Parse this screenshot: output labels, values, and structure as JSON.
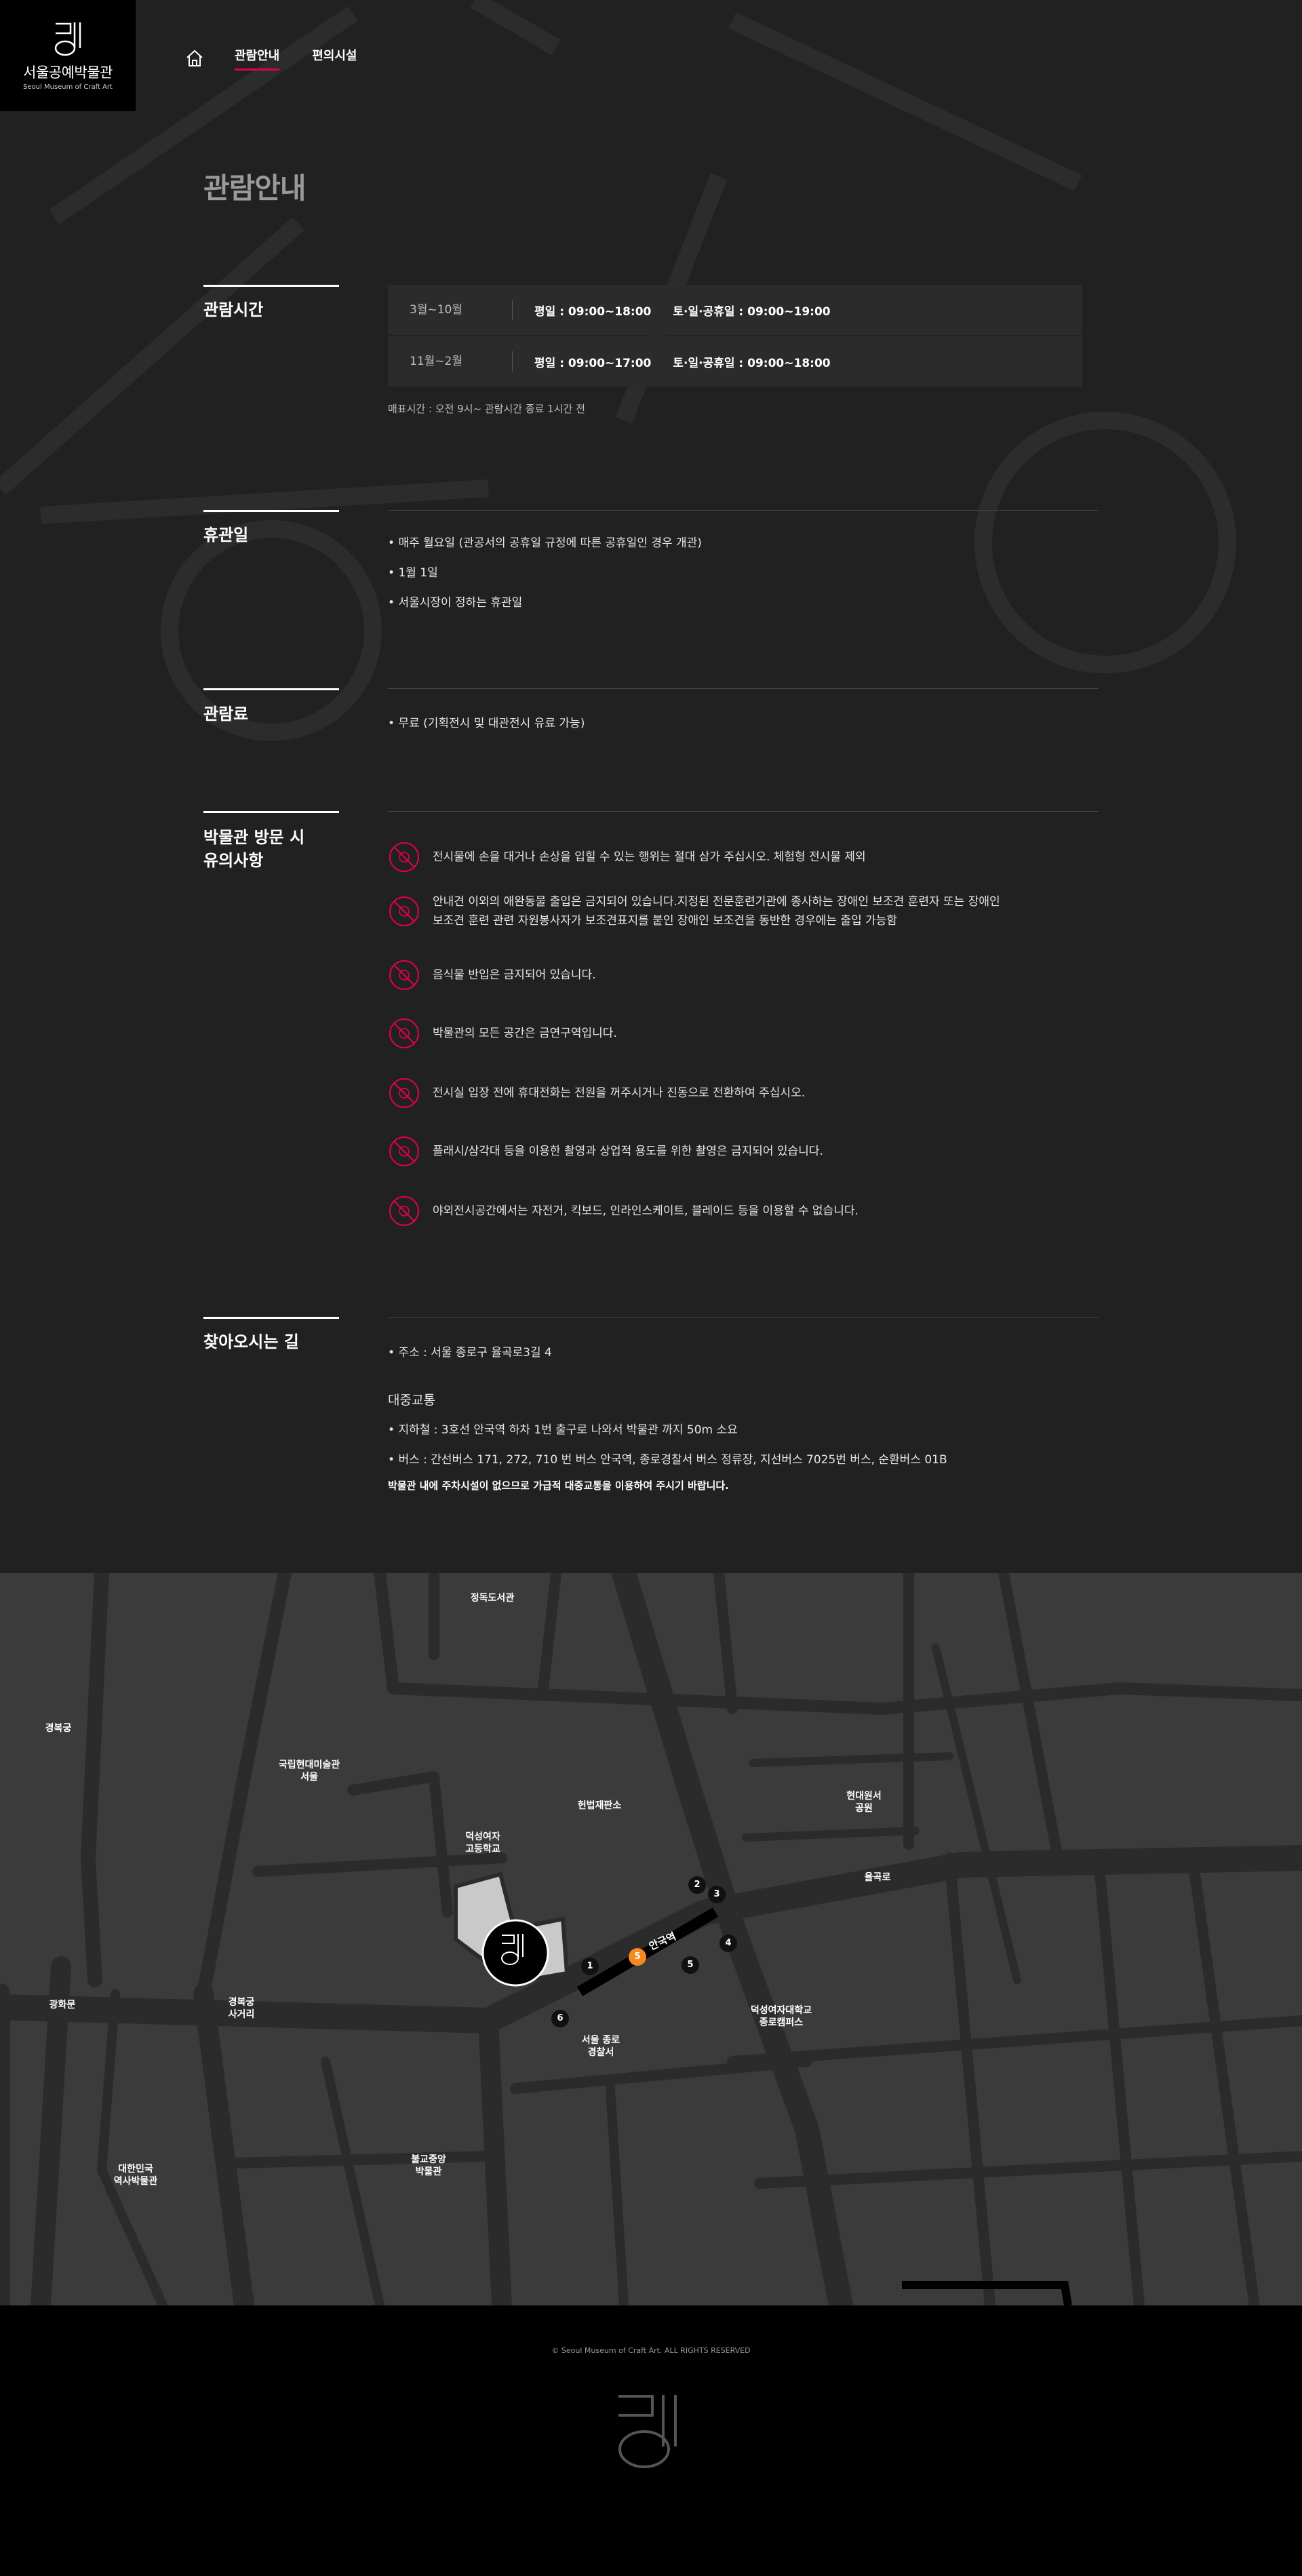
{
  "header": {
    "logo_ko": "서울공예박물관",
    "logo_en": "Seoul Museum of Craft Art",
    "nav": [
      {
        "label": "관람안내",
        "active": true
      },
      {
        "label": "편의시설",
        "active": false
      }
    ],
    "home_icon": "home-icon"
  },
  "page": {
    "title": "관람안내"
  },
  "hours": {
    "title": "관람시간",
    "rows": [
      {
        "season": "3월~10월",
        "weekday": "평일 : 09:00~18:00",
        "weekend": "토·일·공휴일 : 09:00~19:00"
      },
      {
        "season": "11월~2월",
        "weekday": "평일 : 09:00~17:00",
        "weekend": "토·일·공휴일 : 09:00~18:00"
      }
    ],
    "note": "매표시간 : 오전 9시~ 관람시간 종료 1시간 전"
  },
  "closed": {
    "title": "휴관일",
    "items": [
      "매주 월요일 (관공서의 공휴일 규정에 따른 공휴일인 경우 개관)",
      "1월 1일",
      "서울시장이 정하는 휴관일"
    ]
  },
  "fee": {
    "title": "관람료",
    "items": [
      "무료 (기획전시 및 대관전시 유료 가능)"
    ]
  },
  "notices": {
    "title_line1": "박물관 방문 시",
    "title_line2": "유의사항",
    "icon": "prohibited-icon",
    "accent": "#e6004c",
    "items": [
      {
        "line1": "전시물에 손을 대거나 손상을 입힐 수 있는 행위는 절대 삼가 주십시오. 체험형 전시물 제외",
        "line2": ""
      },
      {
        "line1": "안내견 이외의 애완동물 출입은 금지되어 있습니다.지정된 전문훈련기관에 종사하는 장애인 보조견 훈련자 또는 장애인",
        "line2": "보조견 훈련 관련 자원봉사자가 보조견표지를 붙인 장애인 보조견을 동반한 경우에는 출입 가능함"
      },
      {
        "line1": "음식물 반입은 금지되어 있습니다.",
        "line2": ""
      },
      {
        "line1": "박물관의 모든 공간은 금연구역입니다.",
        "line2": ""
      },
      {
        "line1": "전시실 입장 전에 휴대전화는 전원을 꺼주시거나 진동으로 전환하여 주십시오.",
        "line2": ""
      },
      {
        "line1": "플래시/삼각대 등을 이용한 촬영과 상업적 용도를 위한 촬영은 금지되어 있습니다.",
        "line2": ""
      },
      {
        "line1": "야외전시공간에서는 자전거, 킥보드, 인라인스케이트, 블레이드 등을 이용할 수 없습니다.",
        "line2": ""
      }
    ]
  },
  "directions": {
    "title": "찾아오시는 길",
    "address": "주소 : 서울 종로구 율곡로3길 4",
    "transit_heading": "대중교통",
    "subway": "지하철 : 3호선 안국역 하차 1번 출구로 나와서 박물관 까지 50m 소요",
    "bus": "버스 : 간선버스 171, 272, 710 번 버스 안국역, 종로경찰서 버스 정류장, 지선버스 7025번 버스, 순환버스 01B",
    "parking_note": "박물관 내에 주차시설이 없으므로 가급적 대중교통을 이용하여 주시기 바랍니다."
  },
  "map": {
    "labels": {
      "jeongdok": "정독도서관",
      "gyeongbokgung": "경복궁",
      "mmca": "국립현대미술관\n서울",
      "hyundai": "현대원서\n공원",
      "heonbeop": "헌법재판소",
      "duksung_hs": "덕성여자\n고등학교",
      "yulgokro": "율곡로",
      "gwanghwamun": "광화문",
      "gyeongbok_sageori": "경복궁\n사거리",
      "police": "서울 종로\n경찰서",
      "duksung_univ": "덕성여자대학교\n종로캠퍼스",
      "history_museum": "대한민국\n역사박물관",
      "buddhist_museum": "불교중앙\n박물관"
    },
    "station": "안국역",
    "exits": [
      "1",
      "2",
      "3",
      "4",
      "5",
      "6"
    ],
    "highlight_exit": "5",
    "highlight_color": "#f58a1f"
  },
  "footer": {
    "copyright": "© Seoul Museum of Craft Art. ALL RIGHTS RESERVED"
  }
}
